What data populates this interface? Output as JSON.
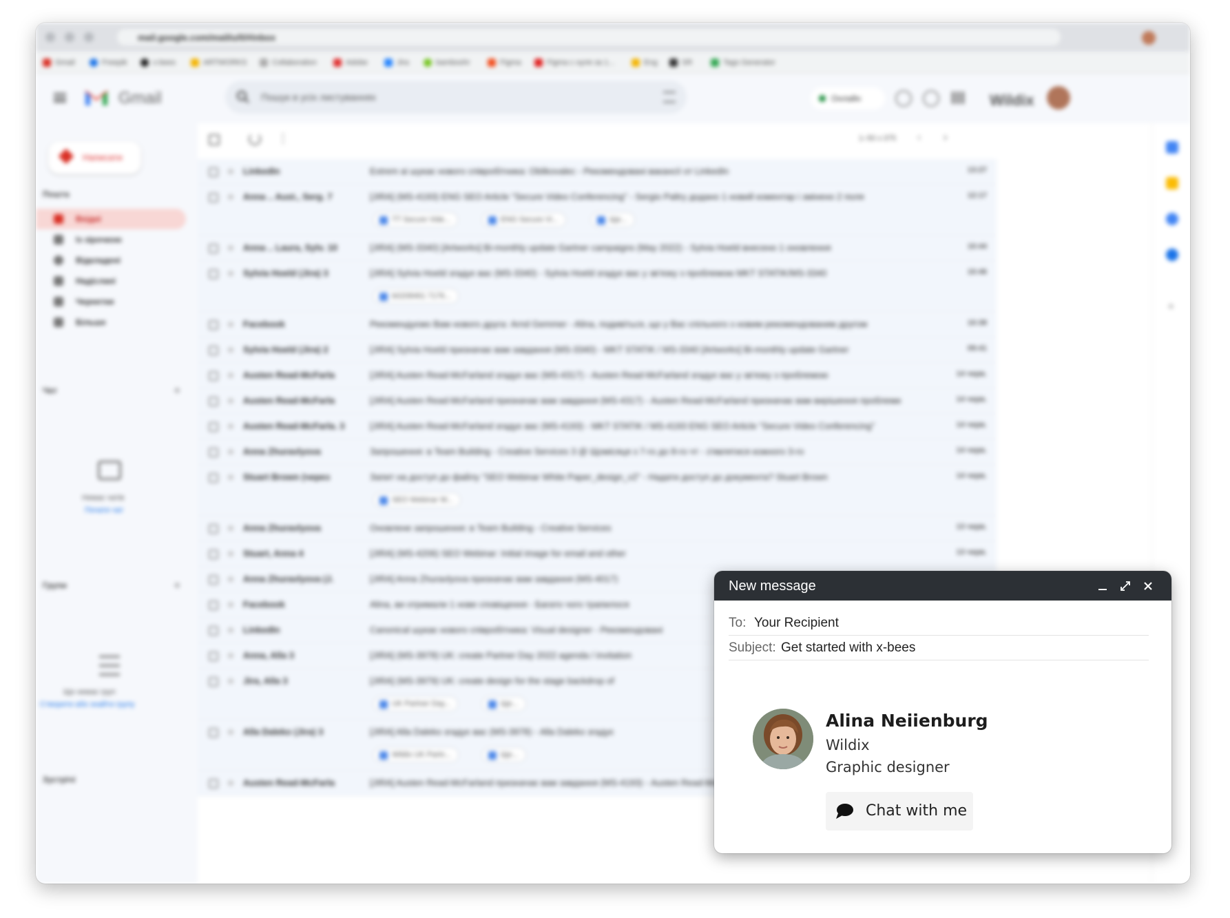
{
  "browser": {
    "url": "mail.google.com/mail/u/0/#inbox",
    "bookmarks": [
      "Gmail",
      "Freepik",
      "x-bees",
      "ARTWORKS",
      "Collaboration",
      "Adobe",
      "Jira",
      "bamboohr",
      "Figma",
      "Figma с нуля за 1...",
      "Eng",
      "SR",
      "Tags Generator"
    ]
  },
  "gmail": {
    "brand": "Gmail",
    "search_placeholder": "Пошук в усіх листуваннях",
    "status_pill": "Онлайн",
    "account_logo": "Wildix",
    "compose_label": "Написати",
    "sections": {
      "mail": "Пошта",
      "chat": "Чат",
      "spaces": "Групи",
      "meet": "Зустрічі"
    },
    "nav": [
      {
        "label": "Вхідні",
        "icon": "inbox-icon",
        "active": true
      },
      {
        "label": "Із зірочкою",
        "icon": "star-icon",
        "active": false
      },
      {
        "label": "Відкладені",
        "icon": "clock-icon",
        "active": false
      },
      {
        "label": "Надіслані",
        "icon": "send-icon",
        "active": false
      },
      {
        "label": "Чернетки",
        "icon": "draft-icon",
        "active": false
      },
      {
        "label": "Більше",
        "icon": "chevron-down-icon",
        "active": false
      }
    ],
    "chat_empty": "Немає чатів",
    "chat_link": "Почати чат",
    "spaces_empty": "Ще немає груп",
    "spaces_link": "Створити або знайти групу",
    "pagination": "1–50 з 375",
    "emails": [
      {
        "from": "LinkedIn",
        "subject": "Extrem ai шукає нового співробітника: Oblikovalec - Рекомендовані вакансії от LinkedIn",
        "time": "13:27",
        "chips": []
      },
      {
        "from": "Anna .. Aust., Serg. 7",
        "subject": "[JIRA] (MS-4193) ENG SEO Article \"Secure Video Conferencing\" - Sergio Paltry додано 1 новий коментар і змінено 2 поля",
        "time": "12:17",
        "chips": [
          "TT Secure Vide...",
          "ENG Secure Vi...",
          "Ще..."
        ]
      },
      {
        "from": "Anna .. Laura, Sylv. 10",
        "subject": "[JIRA] (MS-3340) [Artworks] Bi-monthly update Gartner campaigns (May 2022) - Sylvia Hoeld внесено 1 оновлення",
        "time": "10:44",
        "chips": []
      },
      {
        "from": "Sylvia Hoeld (Jira) 3",
        "subject": "[JIRA] Sylvia Hoeld згадує вас (MS-3340) - Sylvia Hoeld згадує вас у зв'язку з проблемою MKT STATIK/MS-3340",
        "time": "10:46",
        "chips": [
          "b0208461 7176..."
        ]
      },
      {
        "from": "Facebook",
        "subject": "Рекомендуємо Вам нового друга: Arnd Gemmer - Alina, подивіться, що у Вас спільного з новим рекомендованим другом",
        "time": "10:38",
        "chips": []
      },
      {
        "from": "Sylvia Hoeld (Jira) 2",
        "subject": "[JIRA] Sylvia Hoeld призначає вам завдання (MS-3340) - MKT STATIK / MS-3340 [Artworks] Bi-monthly update Gartner",
        "time": "09:41",
        "chips": []
      },
      {
        "from": "Austen Read-McFarla",
        "subject": "[JIRA] Austen Read-McFarland згадує вас (MS-4317) - Austen Read-McFarland згадує вас у зв'язку з проблемою",
        "time": "14 черв.",
        "chips": []
      },
      {
        "from": "Austen Read-McFarla",
        "subject": "[JIRA] Austen Read-McFarland призначає вам завдання (MS-4317) - Austen Read-McFarland призначає вам вирішення проблеми",
        "time": "14 черв.",
        "chips": []
      },
      {
        "from": "Austen Read-McFarla. 3",
        "subject": "[JIRA] Austen Read-McFarland згадує вас (MS-4193) - MKT STATIK / MS-4193 ENG SEO Article \"Secure Video Conferencing\"",
        "time": "14 черв.",
        "chips": []
      },
      {
        "from": "Anna Zhuravlyova",
        "subject": "Запрошення: в Team Building - Creative Services 3 @ Щомісяця з 7-го до 8-го чт - з'являтися кожного 3-го",
        "time": "14 черв.",
        "chips": []
      },
      {
        "from": "Stuart Brown (через",
        "subject": "Запит на доступ до файлу \"SEO Webinar White Paper_design_v2\" - Надати доступ до документа? Stuart Brown",
        "time": "14 черв.",
        "chips": [
          "SEO Webinar W..."
        ]
      },
      {
        "from": "Anna Zhuravlyova",
        "subject": "Оновлене запрошення: в Team Building - Creative Services",
        "time": "13 черв.",
        "chips": []
      },
      {
        "from": "Stuart, Anna 4",
        "subject": "[JIRA] (MS-4206) SEO Webinar: Initial image for email and other",
        "time": "13 черв.",
        "chips": []
      },
      {
        "from": "Anna Zhuravlyova (J.",
        "subject": "[JIRA] Anna Zhuravlyova призначає вам завдання (MS-4017)",
        "time": "13 черв.",
        "chips": []
      },
      {
        "from": "Facebook",
        "subject": "Alina, ви отримали 1 нове сповіщення - Багато чого трапилося",
        "time": "13 черв.",
        "chips": []
      },
      {
        "from": "LinkedIn",
        "subject": "Canonical шукає нового співробітника: Visual designer - Рекомендовані",
        "time": "13 черв.",
        "chips": []
      },
      {
        "from": "Anna, Alla 3",
        "subject": "[JIRA] (MS-3978) UK: create Partner Day 2022 agenda / invitation",
        "time": "13 черв.",
        "chips": []
      },
      {
        "from": "Jira, Alla 3",
        "subject": "[JIRA] (MS-3979) UK: create design for the stage backdrop of",
        "time": "13 черв.",
        "chips": [
          "UK Partner Day...",
          "Ще..."
        ]
      },
      {
        "from": "Alla Daleko (Jira) 3",
        "subject": "[JIRA] Alla Daleko згадує вас (MS-3978) - Alla Daleko згадує",
        "time": "13 черв.",
        "chips": [
          "Wildix UK Partn...",
          "Ще..."
        ]
      },
      {
        "from": "Austen Read-McFarla",
        "subject": "[JIRA] Austen Read-McFarland призначає вам завдання (MS-4193) - Austen Read-McFarland призначає вам вирішення проблеми",
        "time": "13 черв.",
        "chips": []
      }
    ]
  },
  "compose": {
    "title": "New message",
    "to_label": "To:",
    "to_value": "Your Recipient",
    "subject_label": "Subject:",
    "subject_value": "Get started with x-bees",
    "contact_name": "Alina Neiienburg",
    "contact_company": "Wildix",
    "contact_role": "Graphic designer",
    "chat_button": "Chat with me"
  },
  "colors": {
    "compose_header": "#2c3035",
    "gmail_red": "#d93025",
    "active_nav_bg": "#f8d7d5",
    "chip_icon": "#4a86e8"
  }
}
